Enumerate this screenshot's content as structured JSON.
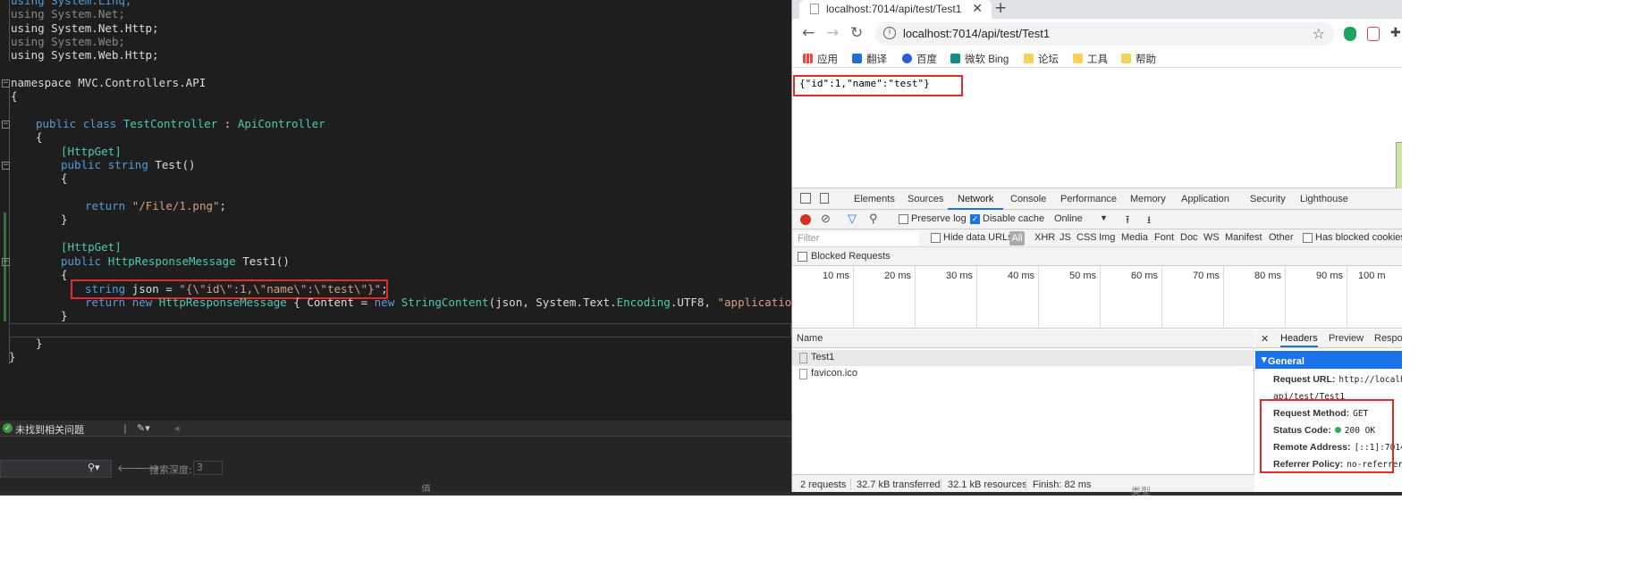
{
  "ide": {
    "lines": {
      "u1": "using System.Linq;",
      "u2": "using System.Net;",
      "u3": "using System.Net.Http;",
      "u4": "using System.Web;",
      "u5": "using System.Web.Http;",
      "ns": "namespace MVC.Controllers.API",
      "brace_open": "{",
      "cls_pub": "public",
      "cls_class": "class",
      "cls_name": "TestController",
      "cls_colon": ":",
      "cls_base": "ApiController",
      "cls_brace": "{",
      "attr1": "[HttpGet]",
      "m1_pub": "public",
      "m1_type": "string",
      "m1_name": "Test()",
      "m1_brace": "{",
      "m1_ret": "return",
      "m1_str": "\"/File/1.png\"",
      "m1_semi": ";",
      "m1_close": "}",
      "attr2": "[HttpGet]",
      "m2_pub": "public",
      "m2_type": "HttpResponseMessage",
      "m2_name": "Test1()",
      "m2_brace": "{",
      "l_string": "string",
      "l_json": " json = ",
      "l_jsonstr": "\"{\\\"id\\\":1,\\\"name\\\":\\\"test\\\"}\"",
      "l_semi": ";",
      "r_return": "return",
      "r_new": "new",
      "r_type": "HttpResponseMessage",
      "r_mid": " { Content = ",
      "r_new2": "new",
      "r_type2": "StringContent",
      "r_args1": "(json, System.Text.",
      "r_enc": "Encoding",
      "r_args2": ".UTF8, ",
      "r_str": "\"application/json\"",
      "r_end": ") }",
      "m2_close": "}",
      "cls_close": "}",
      "ns_close": "}"
    },
    "status": {
      "issues": "未找到相关问题"
    },
    "panel": {
      "search_depth_label": "搜索深度:",
      "search_depth_value": "3",
      "value_col": "值",
      "type_col": "类型"
    }
  },
  "browser": {
    "tab": {
      "title": "localhost:7014/api/test/Test1",
      "close": "✕",
      "new_tab": "+"
    },
    "url": "localhost:7014/api/test/Test1",
    "bookmarks": [
      {
        "label": "应用"
      },
      {
        "label": "翻译"
      },
      {
        "label": "百度"
      },
      {
        "label": "微软 Bing"
      },
      {
        "label": "论坛"
      },
      {
        "label": "工具"
      },
      {
        "label": "帮助"
      }
    ],
    "body_json": "{\"id\":1,\"name\":\"test\"}",
    "devtools": {
      "tabs": [
        "Elements",
        "Sources",
        "Network",
        "Console",
        "Performance",
        "Memory",
        "Application",
        "Security",
        "Lighthouse"
      ],
      "active_tab": "Network",
      "preserve_log": "Preserve log",
      "disable_cache": "Disable cache",
      "throttle": "Online",
      "filter_placeholder": "Filter",
      "hide_data_urls": "Hide data URLs",
      "types": [
        "All",
        "XHR",
        "JS",
        "CSS",
        "Img",
        "Media",
        "Font",
        "Doc",
        "WS",
        "Manifest",
        "Other"
      ],
      "has_blocked_cookies": "Has blocked cookies",
      "blocked_requests": "Blocked Requests",
      "ticks": [
        "10 ms",
        "20 ms",
        "30 ms",
        "40 ms",
        "50 ms",
        "60 ms",
        "70 ms",
        "80 ms",
        "90 ms",
        "100 m"
      ],
      "name_col": "Name",
      "requests": [
        "Test1",
        "favicon.ico"
      ],
      "detail_tabs": {
        "close": "✕",
        "headers": "Headers",
        "preview": "Preview",
        "response": "Respor"
      },
      "general": "General",
      "fields": {
        "request_url_k": "Request URL:",
        "request_url_v": "http://localho",
        "request_url_v2": "api/test/Test1",
        "method_k": "Request Method:",
        "method_v": "GET",
        "status_k": "Status Code:",
        "status_v": "200 OK",
        "remote_k": "Remote Address:",
        "remote_v": "[::1]:7014",
        "referrer_k": "Referrer Policy:",
        "referrer_v": "no-referrer-"
      },
      "status_bar": {
        "requests": "2 requests",
        "transferred": "32.7 kB transferred",
        "resources": "32.1 kB resources",
        "finish": "Finish: 82 ms"
      }
    }
  },
  "colors": {
    "highlight_red": "#e52a2a",
    "chrome_blue": "#1a73e8",
    "ide_bg": "#1e1e1e"
  }
}
